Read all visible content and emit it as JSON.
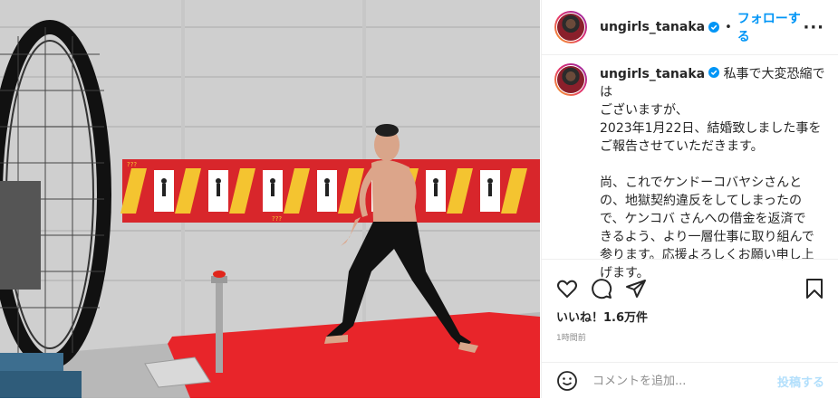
{
  "post": {
    "image_alt": "shirtless man in black leggings on red mat next to giant wheel and red button",
    "banner_marks": "???"
  },
  "header": {
    "username": "ungirls_tanaka",
    "separator": "•",
    "follow_label": "フォローする",
    "more_label": "···"
  },
  "caption": {
    "username": "ungirls_tanaka",
    "lines": [
      "私事で大変恐縮では",
      "ございますが、",
      "2023年1月22日、結婚致しました事を",
      "ご報告させていただきます。",
      "",
      "尚、これでケンドーコバヤシさんと",
      "の、地獄契約違反をしてしまったの",
      "で、ケンコバ さんへの借金を返済で",
      "きるよう、より一層仕事に取り組んで",
      "参ります。応援よろしくお願い申し上",
      "げます。"
    ]
  },
  "actions": {
    "icons": [
      "heart-icon",
      "comment-icon",
      "share-icon",
      "save-icon"
    ]
  },
  "likes": {
    "text": "いいね！1.6万件"
  },
  "timestamp": "1時間前",
  "comment_box": {
    "placeholder": "コメントを追加...",
    "post_label": "投稿する"
  },
  "colors": {
    "accent": "#0095f6",
    "post_disabled": "#b2dffc",
    "mat": "#e8252a",
    "banner": "#d8262b"
  }
}
